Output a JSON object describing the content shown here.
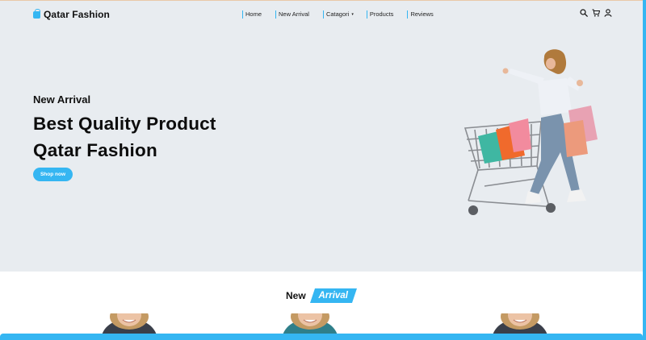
{
  "brand": {
    "name": "Qatar Fashion",
    "icon": "shopping-bag-icon",
    "accent": "#35b6f2"
  },
  "nav": {
    "items": [
      {
        "label": "Home"
      },
      {
        "label": "New Arrival"
      },
      {
        "label": "Catagori",
        "caret": "▾"
      },
      {
        "label": "Products"
      },
      {
        "label": "Reviews"
      }
    ]
  },
  "header_icons": [
    "search-icon",
    "cart-icon",
    "user-icon"
  ],
  "hero": {
    "subtitle": "New Arrival",
    "headline_line1": "Best Quality Product",
    "headline_line2": "Qatar Fashion",
    "cta_label": "Shop now",
    "background": "#e8ecf0"
  },
  "section": {
    "title_word1": "New",
    "title_word2": "Arrival"
  }
}
